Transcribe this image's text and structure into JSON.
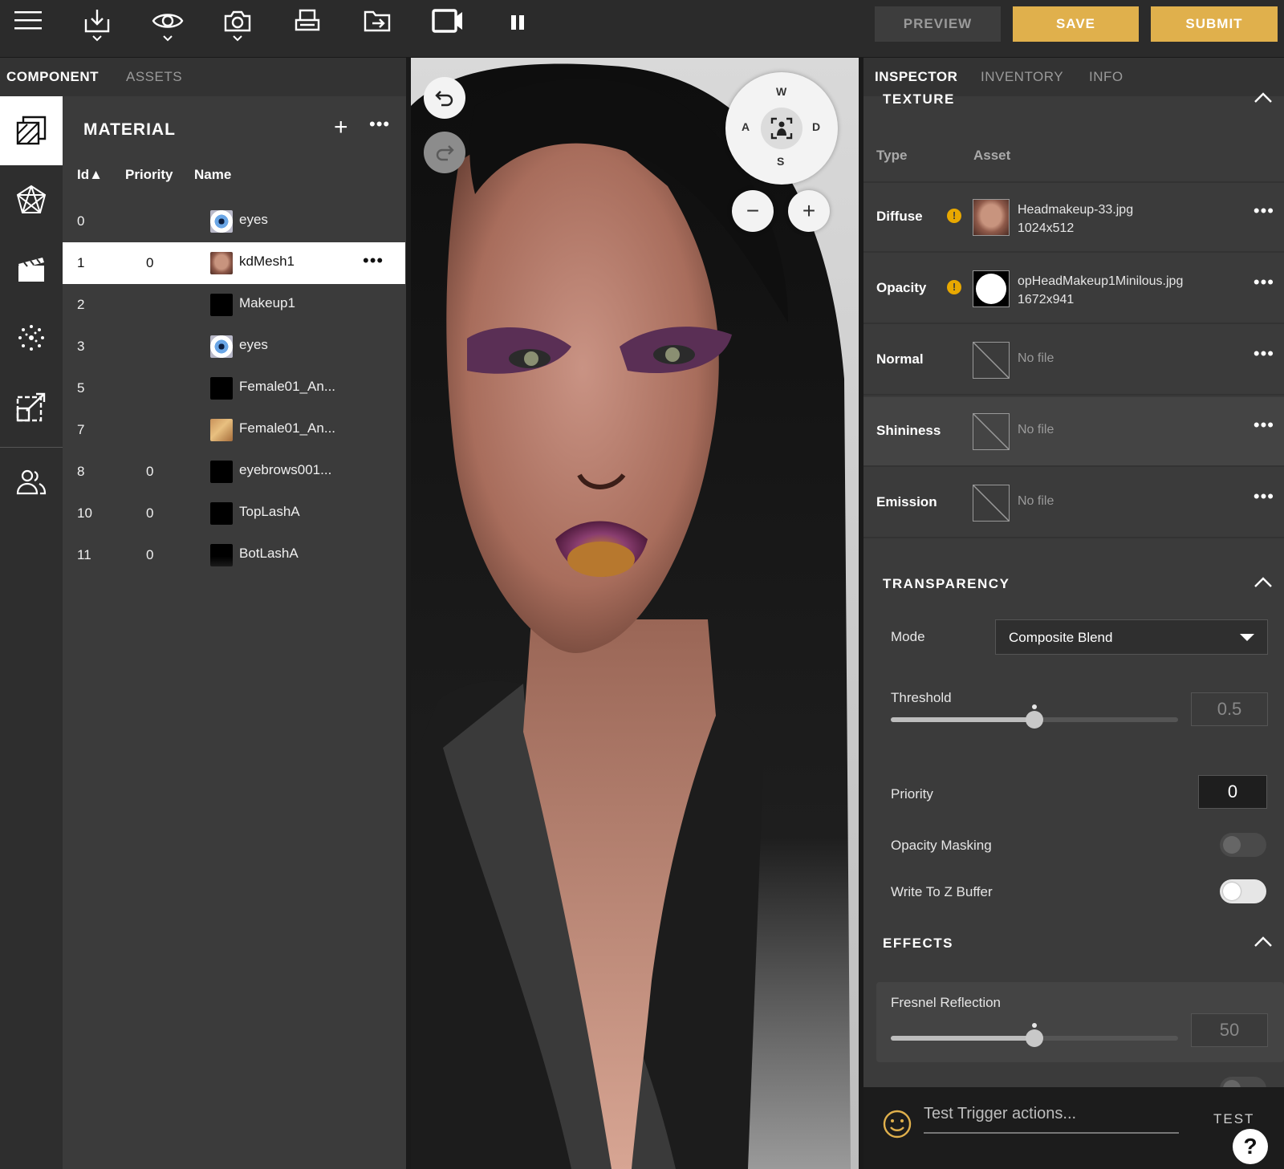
{
  "toolbar": {
    "icons": [
      "menu-icon",
      "download-icon",
      "eye-icon",
      "camera-icon",
      "print-icon",
      "export-icon",
      "video-icon",
      "pause-icon"
    ],
    "preview_label": "PREVIEW",
    "save_label": "SAVE",
    "submit_label": "SUBMIT",
    "accent_color": "#e0b04c"
  },
  "left_tabs": {
    "component": "COMPONENT",
    "assets": "ASSETS"
  },
  "rail": [
    "materials-icon",
    "mesh-icon",
    "scene-icon",
    "particles-icon",
    "transform-icon",
    "users-icon"
  ],
  "material": {
    "title": "MATERIAL",
    "add_symbol": "+",
    "more_symbol": "•••",
    "columns": {
      "id": "Id▲",
      "priority": "Priority",
      "name": "Name"
    },
    "rows": [
      {
        "id": "0",
        "priority": "",
        "name": "eyes",
        "thumb": "eye"
      },
      {
        "id": "1",
        "priority": "0",
        "name": "kdMesh1",
        "thumb": "face",
        "selected": true,
        "more": "•••"
      },
      {
        "id": "2",
        "priority": "",
        "name": "Makeup1",
        "thumb": "black"
      },
      {
        "id": "3",
        "priority": "",
        "name": "eyes",
        "thumb": "eye"
      },
      {
        "id": "5",
        "priority": "",
        "name": "Female01_An...",
        "thumb": "black"
      },
      {
        "id": "7",
        "priority": "",
        "name": "Female01_An...",
        "thumb": "skin"
      },
      {
        "id": "8",
        "priority": "0",
        "name": "eyebrows001...",
        "thumb": "black"
      },
      {
        "id": "10",
        "priority": "0",
        "name": "TopLashA",
        "thumb": "black"
      },
      {
        "id": "11",
        "priority": "0",
        "name": "BotLashA",
        "thumb": "lash"
      }
    ]
  },
  "viewport": {
    "compass": {
      "w": "W",
      "a": "A",
      "s": "S",
      "d": "D"
    },
    "zoom_out": "−",
    "zoom_in": "+"
  },
  "inspector_tabs": {
    "inspector": "INSPECTOR",
    "inventory": "INVENTORY",
    "info": "INFO"
  },
  "texture": {
    "title": "TEXTURE",
    "col_type": "Type",
    "col_asset": "Asset",
    "rows": [
      {
        "type": "Diffuse",
        "warning": "!",
        "file": "Headmakeup-33.jpg",
        "size": "1024x512",
        "thumb": "face"
      },
      {
        "type": "Opacity",
        "warning": "!",
        "file": "opHeadMakeup1Minilous.jpg",
        "size": "1672x941",
        "thumb": "white"
      },
      {
        "type": "Normal",
        "file": "No file",
        "thumb": "none"
      },
      {
        "type": "Shininess",
        "file": "No file",
        "thumb": "none"
      },
      {
        "type": "Emission",
        "file": "No file",
        "thumb": "none"
      }
    ],
    "more_symbol": "•••"
  },
  "transparency": {
    "title": "TRANSPARENCY",
    "mode_label": "Mode",
    "mode_value": "Composite Blend",
    "threshold_label": "Threshold",
    "threshold_value": "0.5",
    "threshold_fraction": 0.5,
    "priority_label": "Priority",
    "priority_value": "0",
    "opacity_masking_label": "Opacity Masking",
    "opacity_masking_on": false,
    "write_z_label": "Write To Z Buffer",
    "write_z_on": false
  },
  "effects": {
    "title": "EFFECTS",
    "fresnel_label": "Fresnel Reflection",
    "fresnel_value": "50",
    "fresnel_fraction": 0.5
  },
  "trigger": {
    "placeholder": "Test Trigger actions...",
    "test_label": "TEST",
    "help_label": "?"
  }
}
